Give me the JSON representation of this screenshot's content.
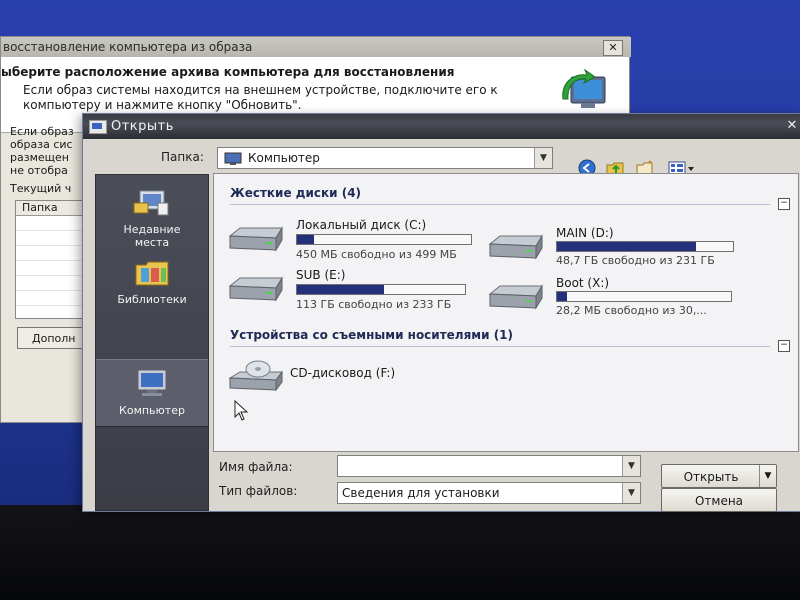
{
  "wizard": {
    "title": "восстановление компьютера из образа",
    "heading": "ыберите расположение архива компьютера для восстановления",
    "subheading_line1": "Если образ системы находится на внешнем устройстве, подключите его к",
    "subheading_line2": "компьютеру и нажмите кнопку \"Обновить\".",
    "body_lines": [
      "Если образ",
      "образа сис",
      "размещен",
      "не отобра"
    ],
    "current_label": "Текущий ч",
    "table_header": "Папка",
    "more_button": "Дополн",
    "close_glyph": "✕"
  },
  "dialog": {
    "title": "Открыть",
    "close_glyph": "✕",
    "folder_label": "Папка:",
    "folder_value": "Компьютер",
    "places": [
      {
        "label_line1": "Недавние",
        "label_line2": "места"
      },
      {
        "label_line1": "Библиотеки",
        "label_line2": ""
      },
      {
        "label_line1": "Компьютер",
        "label_line2": ""
      }
    ],
    "groups": {
      "hard_disks": "Жесткие диски (4)",
      "removable": "Устройства со съемными носителями (1)"
    },
    "collapse_glyph": "−",
    "drives": [
      {
        "name": "Локальный диск (C:)",
        "info": "450 МБ свободно из 499 МБ",
        "used_fraction": 0.1
      },
      {
        "name": "MAIN (D:)",
        "info": "48,7 ГБ свободно из 231 ГБ",
        "used_fraction": 0.79
      },
      {
        "name": "SUB (E:)",
        "info": "113 ГБ свободно из 233 ГБ",
        "used_fraction": 0.52
      },
      {
        "name": "Boot (X:)",
        "info": "28,2 МБ свободно из 30,...",
        "used_fraction": 0.06
      }
    ],
    "cd_drive": "CD-дисковод (F:)",
    "filename_label": "Имя файла:",
    "filename_value": "",
    "filetype_label": "Тип файлов:",
    "filetype_value": "Сведения для установки",
    "open_button": "Открыть",
    "cancel_button": "Отмена",
    "dropdown_glyph": "▼"
  },
  "colors": {
    "desktop": "#2a3fae",
    "titlebar": "#3b3c44",
    "usage_bar": "#25307c"
  }
}
